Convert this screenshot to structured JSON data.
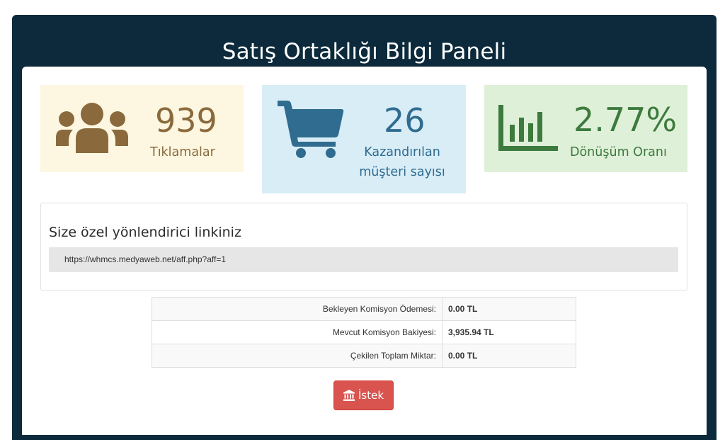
{
  "header": {
    "title": "Satış Ortaklığı Bilgi Paneli"
  },
  "stats": {
    "clicks": {
      "value": "939",
      "label": "Tıklamalar",
      "icon": "users-icon"
    },
    "customers": {
      "value": "26",
      "label_line1": "Kazandırılan",
      "label_line2": "müşteri sayısı",
      "icon": "shopping-cart-icon"
    },
    "conversion": {
      "value": "2.77%",
      "label": "Dönüşüm Oranı",
      "icon": "bar-chart-icon"
    }
  },
  "referral": {
    "title": "Size özel yönlendirici linkiniz",
    "url": "https://whmcs.medyaweb.net/aff.php?aff=1"
  },
  "commission_table": [
    {
      "label": "Bekleyen Komisyon Ödemesi:",
      "value": "0.00 TL"
    },
    {
      "label": "Mevcut Komisyon Bakiyesi:",
      "value": "3,935.94 TL"
    },
    {
      "label": "Çekilen Toplam Miktar:",
      "value": "0.00 TL"
    }
  ],
  "request_button": {
    "label": "İstek",
    "icon": "bank-icon"
  },
  "colors": {
    "header_bg": "#0c2a3b",
    "warning_bg": "#fdf7e1",
    "warning_text": "#8a6a3c",
    "info_bg": "#d9edf7",
    "info_text": "#2f6c8f",
    "success_bg": "#dff0d8",
    "success_text": "#3c7a3d",
    "danger": "#d9534f"
  }
}
